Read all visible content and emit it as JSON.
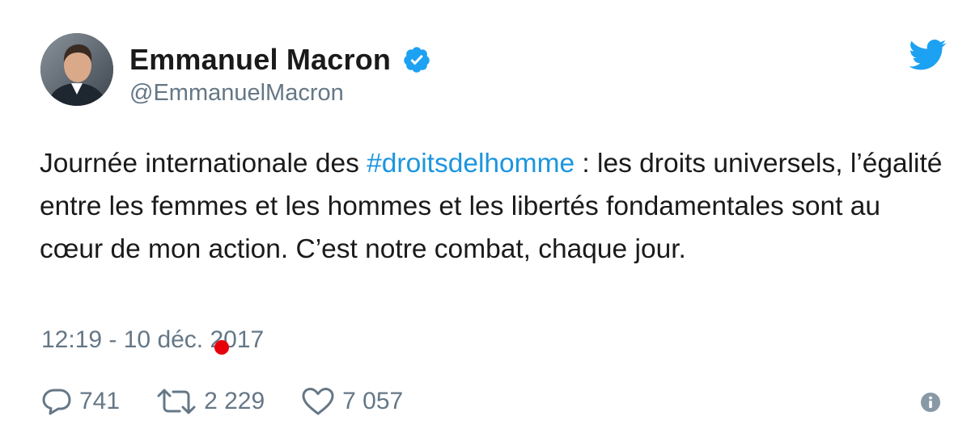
{
  "author": {
    "name": "Emmanuel Macron",
    "handle": "@EmmanuelMacron"
  },
  "tweet": {
    "text_before": "Journée internationale des ",
    "hashtag": "#droitsdelhomme",
    "text_after": " : les droits universels, l’égalité entre les femmes et les hommes et les libertés fondamentales sont au cœur de mon action. C’est notre combat, chaque jour.",
    "timestamp": "12:19 - 10 déc. 2017"
  },
  "stats": {
    "replies": "741",
    "retweets": "2 229",
    "likes": "7 057"
  },
  "icons": {
    "brand": "twitter-bird-icon",
    "verified": "verified-badge-icon",
    "reply": "reply-icon",
    "retweet": "retweet-icon",
    "like": "heart-icon",
    "info": "info-icon"
  },
  "colors": {
    "brand": "#1da1f2",
    "hashtag": "#1b95e0",
    "muted": "#657786",
    "marker": "#e6000a"
  }
}
